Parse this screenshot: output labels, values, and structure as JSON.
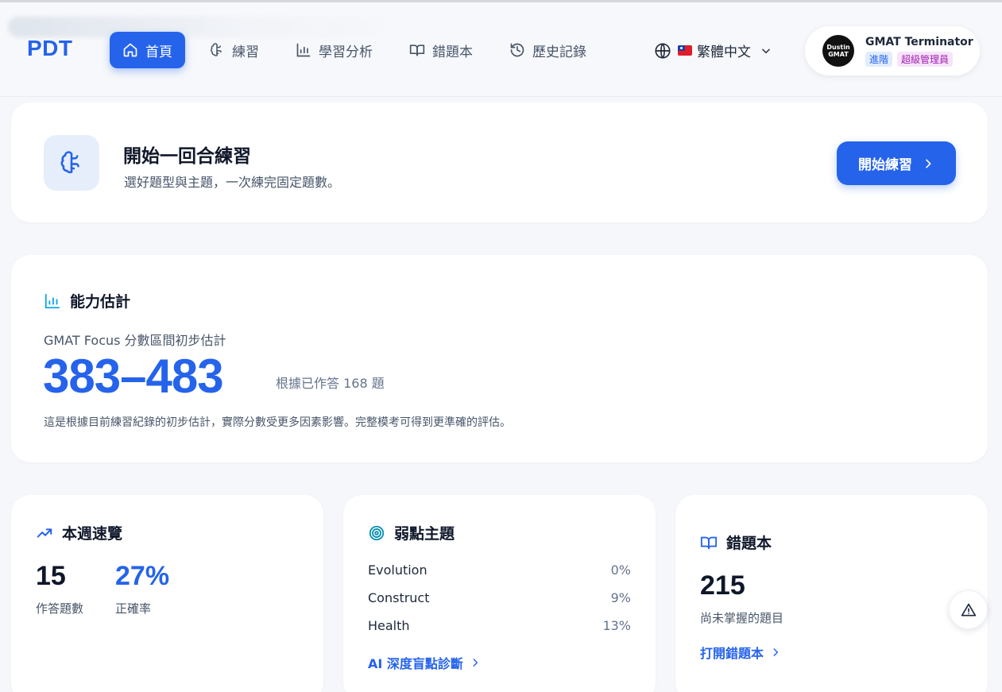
{
  "app": {
    "logo": "PDT"
  },
  "nav": {
    "items": [
      {
        "label": "首頁",
        "icon": "home-icon",
        "active": true
      },
      {
        "label": "練習",
        "icon": "brain-icon"
      },
      {
        "label": "學習分析",
        "icon": "bar-chart-icon"
      },
      {
        "label": "錯題本",
        "icon": "book-open-icon"
      },
      {
        "label": "歷史記錄",
        "icon": "history-icon"
      }
    ]
  },
  "language": {
    "label": "繁體中文",
    "flag": "taiwan-flag-icon"
  },
  "user": {
    "avatar_line1": "Dustin",
    "avatar_line2": "GMAT",
    "name": "GMAT Terminator",
    "badge_level": "進階",
    "badge_role": "超級管理員"
  },
  "start": {
    "title": "開始一回合練習",
    "subtitle": "選好題型與主題，一次練完固定題數。",
    "button": "開始練習"
  },
  "ability": {
    "title": "能力估計",
    "label": "GMAT Focus 分數區間初步估計",
    "score": "383–483",
    "note": "根據已作答 168 題",
    "description": "這是根據目前練習紀錄的初步估計，實際分數受更多因素影響。完整模考可得到更準確的評估。"
  },
  "week": {
    "title": "本週速覽",
    "answered_value": "15",
    "answered_label": "作答題數",
    "accuracy_value": "27%",
    "accuracy_label": "正確率"
  },
  "weak": {
    "title": "弱點主題",
    "topics": [
      {
        "name": "Evolution",
        "pct": "0%"
      },
      {
        "name": "Construct",
        "pct": "9%"
      },
      {
        "name": "Health",
        "pct": "13%"
      }
    ],
    "link": "AI 深度盲點診斷"
  },
  "wrongbook": {
    "title": "錯題本",
    "count": "215",
    "count_label": "尚未掌握的題目",
    "link": "打開錯題本"
  },
  "colors": {
    "accent": "#2563eb",
    "text": "#0f172a",
    "muted": "#475569",
    "background": "#f5f7fa"
  }
}
